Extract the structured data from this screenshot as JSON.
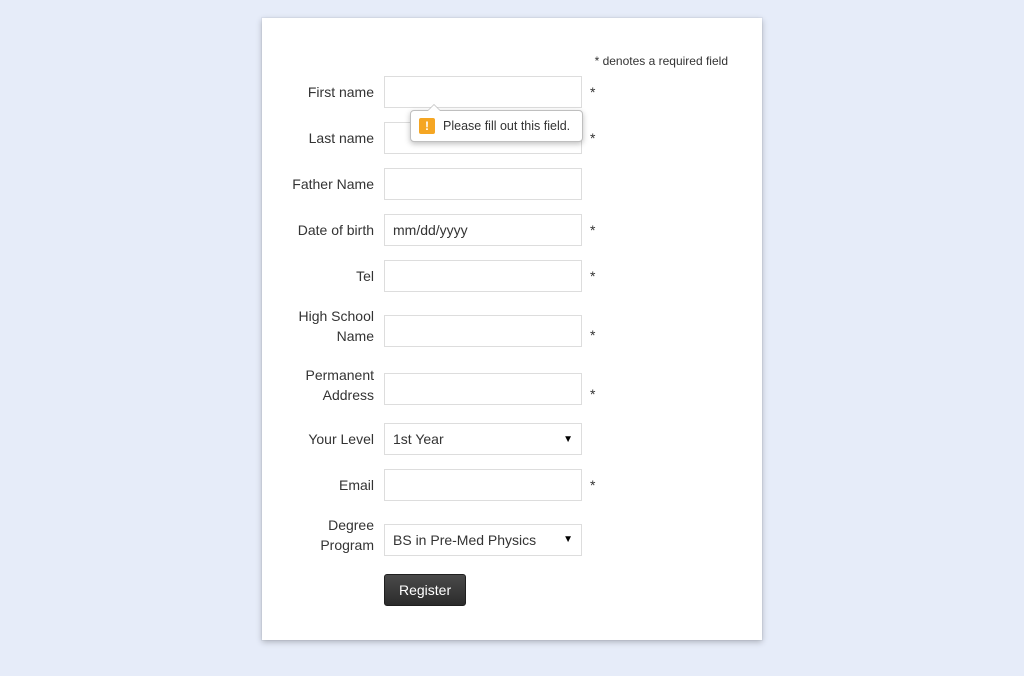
{
  "required_note": "* denotes a required field",
  "tooltip": {
    "text": "Please fill out this field."
  },
  "fields": {
    "first_name": {
      "label": "First name",
      "required": true
    },
    "last_name": {
      "label": "Last name",
      "required": true
    },
    "father_name": {
      "label": "Father Name",
      "required": false
    },
    "dob": {
      "label": "Date of birth",
      "required": true,
      "placeholder": "mm/dd/yyyy"
    },
    "tel": {
      "label": "Tel",
      "required": true
    },
    "highschool": {
      "label": "High School Name",
      "required": true
    },
    "address": {
      "label": "Permanent Address",
      "required": true
    },
    "level": {
      "label": "Your Level",
      "value": "1st Year"
    },
    "email": {
      "label": "Email",
      "required": true
    },
    "degree": {
      "label": "Degree Program",
      "value": "BS in Pre-Med Physics"
    }
  },
  "submit_label": "Register"
}
